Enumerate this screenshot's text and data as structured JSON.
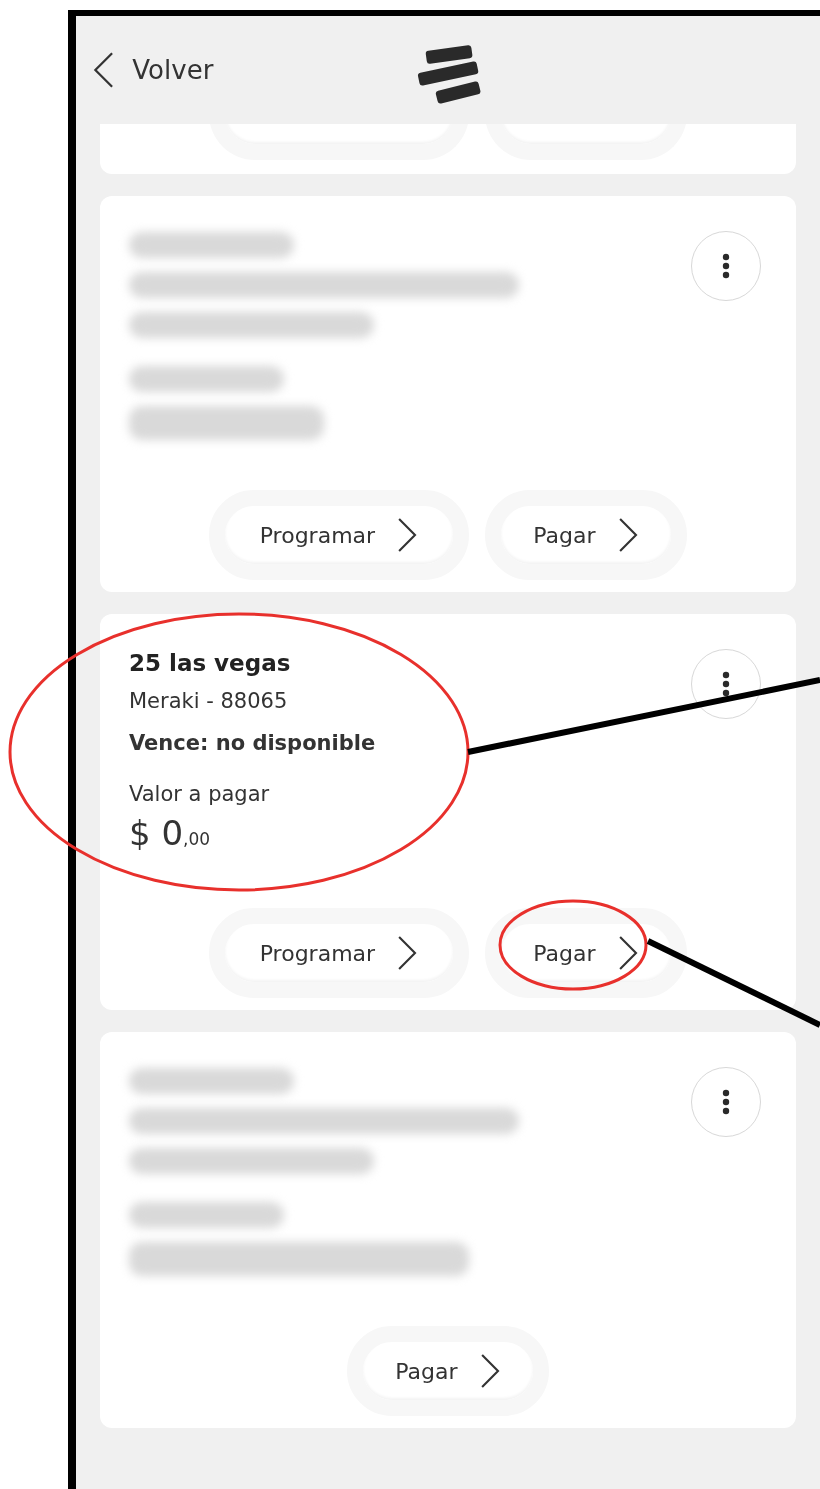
{
  "header": {
    "back_label": "Volver"
  },
  "cards": [
    {
      "fragment": true,
      "actions": [
        {
          "kind": "programar"
        },
        {
          "kind": "pagar"
        }
      ]
    },
    {
      "fragment": false,
      "redacted": true,
      "actions": [
        {
          "kind": "programar",
          "label": "Programar"
        },
        {
          "kind": "pagar",
          "label": "Pagar"
        }
      ]
    },
    {
      "fragment": false,
      "redacted": false,
      "title": "25 las vegas",
      "subtitle": "Meraki - 88065",
      "due": "Vence: no disponible",
      "amount_label": "Valor a pagar",
      "amount": "$ 0",
      "cents": ",00",
      "actions": [
        {
          "kind": "programar",
          "label": "Programar"
        },
        {
          "kind": "pagar",
          "label": "Pagar"
        }
      ]
    },
    {
      "fragment": false,
      "redacted": true,
      "actions": [
        {
          "kind": "pagar",
          "label": "Pagar"
        }
      ]
    }
  ]
}
